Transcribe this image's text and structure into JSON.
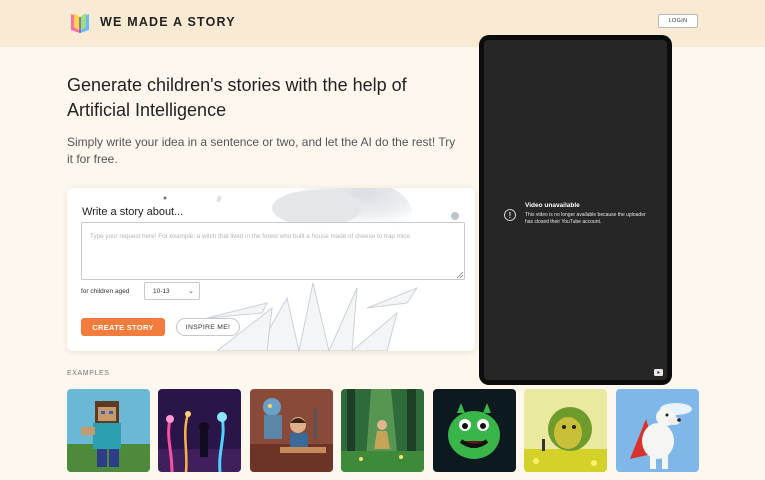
{
  "header": {
    "brand": "WE MADE A STORY",
    "logo_icon": "book-icon",
    "login_label": "LOGIN"
  },
  "hero": {
    "headline": "Generate children's stories with the help of Artificial Intelligence",
    "subline": "Simply write your idea in a sentence or two, and let the AI do the rest! Try it for free."
  },
  "story_form": {
    "title": "Write a story about...",
    "input_value": "",
    "input_placeholder": "Type your request here! For example: a witch that lived in the forest who built a house made of cheese to trap mice",
    "age_label": "for children aged",
    "age_selected": "10-13",
    "create_label": "CREATE STORY",
    "inspire_label": "INSPIRE ME!"
  },
  "video": {
    "title": "Video unavailable",
    "message": "This video is no longer available because the uploader has closed their YouTube account.",
    "warning_icon": "warning-icon",
    "youtube_icon": "youtube-icon"
  },
  "examples": {
    "label": "EXAMPLES",
    "items": [
      {
        "subject": "blocky-hero-illustration"
      },
      {
        "subject": "neon-forest-silhouette"
      },
      {
        "subject": "robot-and-child-workshop"
      },
      {
        "subject": "girl-in-green-forest"
      },
      {
        "subject": "green-monster"
      },
      {
        "subject": "yellow-fluffy-creature"
      },
      {
        "subject": "white-dog-red-cape"
      }
    ]
  },
  "colors": {
    "topbar": "#f9ead3",
    "page": "#fdf7ee",
    "accent": "#f27c3c",
    "video_bg": "#262626"
  }
}
